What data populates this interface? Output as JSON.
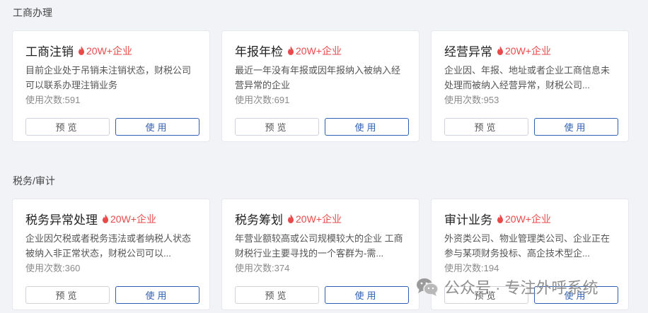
{
  "sections": [
    {
      "title": "工商办理"
    },
    {
      "title": "税务/审计"
    }
  ],
  "colors": {
    "accent": "#2f5fb3",
    "hot": "#e84a4a",
    "background": "#f2f3f6"
  },
  "cards": [
    {
      "title": "工商注销",
      "hot": "20W+企业",
      "desc": "目前企业处于吊销未注销状态，财税公司可以联系办理注销业务",
      "usage": "使用次数:591",
      "preview": "预览",
      "use": "使用"
    },
    {
      "title": "年报年检",
      "hot": "20W+企业",
      "desc": "最近一年没有年报或因年报纳入被纳入经营异常的企业",
      "usage": "使用次数:691",
      "preview": "预览",
      "use": "使用"
    },
    {
      "title": "经营异常",
      "hot": "20W+企业",
      "desc": "企业因、年报、地址或者企业工商信息未处理而被纳入经营异常，财税公司...",
      "usage": "使用次数:953",
      "preview": "预览",
      "use": "使用"
    },
    {
      "title": "税务异常处理",
      "hot": "20W+企业",
      "desc": "企业因欠税或者税务违法或者纳税人状态被纳入非正常状态，财税公司可以...",
      "usage": "使用次数:360",
      "preview": "预览",
      "use": "使用"
    },
    {
      "title": "税务筹划",
      "hot": "20W+企业",
      "desc": "年营业额较高或公司规模较大的企业 工商财税行业主要寻找的一个客群为-需...",
      "usage": "使用次数:374",
      "preview": "预览",
      "use": "使用"
    },
    {
      "title": "审计业务",
      "hot": "20W+企业",
      "desc": "外资类公司、物业管理类公司、企业正在参与某项财务投标、高企技术型企...",
      "usage": "使用次数:194",
      "preview": "预览",
      "use": "使用"
    }
  ],
  "watermark": {
    "icon": "wechat-icon",
    "text": "公众号 · 专注外呼系统"
  }
}
